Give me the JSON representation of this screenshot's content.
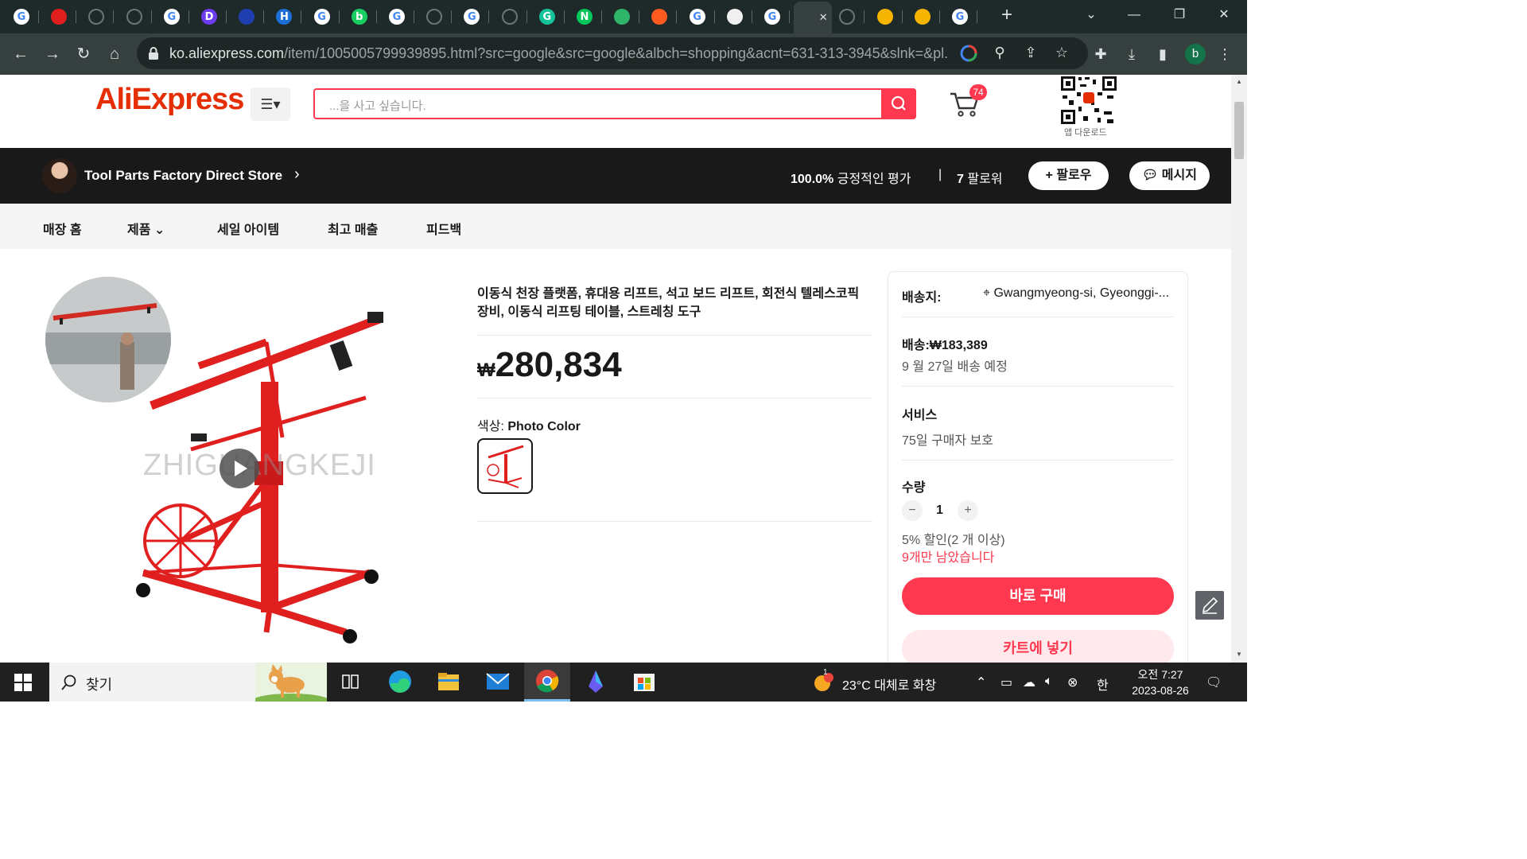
{
  "browser": {
    "tabs": [
      {
        "icon": "google-icon",
        "letter": "G",
        "color": "#ffffff"
      },
      {
        "icon": "red-app-icon",
        "letter": "",
        "color": "#e01e1e"
      },
      {
        "icon": "globe-icon",
        "letter": "",
        "color": "#6b7574"
      },
      {
        "icon": "globe-icon",
        "letter": "",
        "color": "#6b7574"
      },
      {
        "icon": "google-icon",
        "letter": "G",
        "color": "#ffffff"
      },
      {
        "icon": "d-app-icon",
        "letter": "D",
        "color": "#6c3cf0"
      },
      {
        "icon": "circle-app-icon",
        "letter": "",
        "color": "#1f3fb0"
      },
      {
        "icon": "h-app-icon",
        "letter": "H",
        "color": "#1b6fd6"
      },
      {
        "icon": "google-icon",
        "letter": "G",
        "color": "#ffffff"
      },
      {
        "icon": "blog-icon",
        "letter": "b",
        "color": "#19ce60"
      },
      {
        "icon": "google-icon",
        "letter": "G",
        "color": "#ffffff"
      },
      {
        "icon": "globe-icon",
        "letter": "",
        "color": "#6b7574"
      },
      {
        "icon": "google-icon",
        "letter": "G",
        "color": "#ffffff"
      },
      {
        "icon": "globe-icon",
        "letter": "",
        "color": "#6b7574"
      },
      {
        "icon": "grammarly-icon",
        "letter": "G",
        "color": "#15c39a"
      },
      {
        "icon": "naver-icon",
        "letter": "N",
        "color": "#03c75a"
      },
      {
        "icon": "save-app-icon",
        "letter": "",
        "color": "#2fb56a"
      },
      {
        "icon": "shop-app-icon",
        "letter": "",
        "color": "#ff5a1f"
      },
      {
        "icon": "google-icon",
        "letter": "G",
        "color": "#ffffff"
      },
      {
        "icon": "doc-app-icon",
        "letter": "",
        "color": "#f0f0f0"
      },
      {
        "icon": "google-icon",
        "letter": "G",
        "color": "#ffffff"
      },
      {
        "icon": "aliexpress-icon",
        "letter": "",
        "color": "#35403f"
      },
      {
        "icon": "globe-icon",
        "letter": "",
        "color": "#6b7574"
      },
      {
        "icon": "emoji-app-icon",
        "letter": "",
        "color": "#f5b400"
      },
      {
        "icon": "emoji-app-icon",
        "letter": "",
        "color": "#f5b400"
      },
      {
        "icon": "google-icon",
        "letter": "G",
        "color": "#ffffff"
      }
    ],
    "active_tab_index": 21,
    "url_host": "ko.aliexpress.com",
    "url_path": "/item/1005005799939895.html?src=google&src=google&albch=shopping&acnt=631-313-3945&slnk=&pl..."
  },
  "header": {
    "logo": "AliExpress",
    "search_placeholder": "...을 사고 싶습니다.",
    "cart_count": "74",
    "app_download": "앱 다운로드"
  },
  "store": {
    "name": "Tool Parts Factory Direct Store",
    "rating_value": "100.0%",
    "rating_label": "긍정적인 평가",
    "divider": "|",
    "followers_value": "7",
    "followers_label": "팔로워",
    "follow_btn": "팔로우",
    "message_btn": "메시지"
  },
  "store_nav": [
    "매장 홈",
    "제품",
    "세일 아이템",
    "최고 매출",
    "피드백"
  ],
  "product": {
    "title": "이동식 천장 플랫폼, 휴대용 리프트, 석고 보드 리프트, 회전식 텔레스코픽 장비, 이동식 리프팅 테이블, 스트레칭 도구",
    "currency": "₩",
    "price": "280,834",
    "color_label": "색상:",
    "color_value": "Photo Color",
    "watermark": "ZHIGUANGKEJI"
  },
  "panel": {
    "ship_to_label": "배송지:",
    "ship_to_value": "Gwangmyeong-si, Gyeonggi-...",
    "shipping_label": "배송:",
    "shipping_price": "₩183,389",
    "delivery_date": "9 월 27일 배송 예정",
    "service_label": "서비스",
    "service_value": "75일 구매자 보호",
    "qty_label": "수량",
    "qty_value": "1",
    "discount": "5% 할인(2 개 이상)",
    "stock": "9개만 남았습니다",
    "buy_now": "바로 구매",
    "add_to_cart": "카트에 넣기"
  },
  "taskbar": {
    "search_text": "찾기",
    "weather": "23°C  대체로 화창",
    "weather_badge": "1",
    "ime": "한",
    "time": "오전 7:27",
    "date": "2023-08-26"
  }
}
